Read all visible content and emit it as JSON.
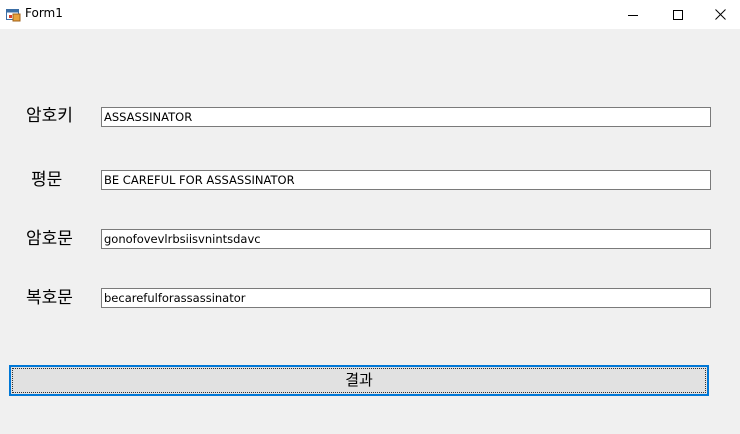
{
  "window": {
    "title": "Form1",
    "icons": {
      "app": "winforms-app-icon",
      "minimize": "minimize-icon",
      "maximize": "maximize-icon",
      "close": "close-icon"
    }
  },
  "form": {
    "fields": [
      {
        "label": "암호키",
        "value": "ASSASSINATOR"
      },
      {
        "label": "평문",
        "value": "BE CAREFUL FOR ASSASSINATOR"
      },
      {
        "label": "암호문",
        "value": "gonofovevlrbsiisvnintsdavc"
      },
      {
        "label": "복호문",
        "value": "becarefulforassassinator"
      }
    ],
    "result_button_label": "결과"
  },
  "colors": {
    "window_bg": "#f0f0f0",
    "focus_border": "#0078d7",
    "button_bg": "#e1e1e1"
  }
}
